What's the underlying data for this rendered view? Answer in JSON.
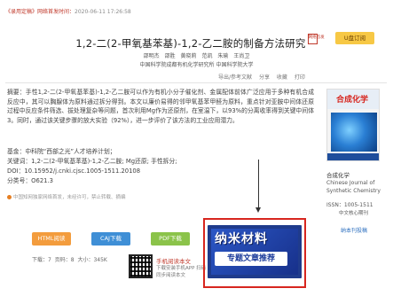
{
  "header": {
    "lead": "《录用定稿》网络首发时间：",
    "datetime": "2020-06-11 17:26:58",
    "title": "1,2-二(2-甲氧基苯基)-1,2-乙二胺的制备方法研究",
    "title_badge": "网络首发",
    "authors": [
      "邵明杰",
      "邵胜",
      "黄晓莉",
      "范凯",
      "朱瑜",
      "王尚卫"
    ],
    "affiliation": "中国科学院成都有机化学研究所    中国科学院大学",
    "u_button": "U盘订阅"
  },
  "toolbar": {
    "items": [
      "导出/参考文献",
      "分享",
      "收藏",
      "打印"
    ]
  },
  "abstract": {
    "text": "摘要：手性1,2-二(2-甲氧基苯基)-1,2-乙二胺可以作为有机小分子催化剂、金属配体前体广泛应用于多种有机合成反应中，其可以胸腺体为原料通过拆分得到。本文以廉价易得的邻甲氧基苯甲醛为原料，重点针对亚胺中间体还原过程中反应条件筛选、拔处理复杂等问题，首次利用Mg作为还原剂，在室温下，以93%的分离收率得到关键中间体3。同时，通过该关键步骤的放大实验（92%），进一步评价了该方法的工业应用潜力。",
    "fund": "基金：中科院“西部之光”人才培养计划；",
    "keywords": "关键词：1,2-二(2-甲氧基苯基)-1,2-乙二胺; Mg还原; 手性拆分;",
    "doi": "DOI：10.15952/j.cnki.cjsc.1005-1511.20108",
    "clc": "分类号：O621.3",
    "note": "中国知网独家网络首发，未经许可，禁止转载、摘编"
  },
  "downloads": {
    "html": "HTML阅读",
    "caj": "CAJ下载",
    "pdf": "PDF下载",
    "stats": "下载：7   页码：8   大小：345K"
  },
  "app_promo": {
    "title": "手机阅读本文",
    "desc": "下载安装手机APP 扫码同步阅读本文"
  },
  "ad": {
    "line1": "纳米材料",
    "line2": "专题文章推荐"
  },
  "journal": {
    "cover_name": "合成化学",
    "cn_name": "合成化学",
    "en_name": "Chinese Journal of Synthetic Chemistry",
    "issn": "ISSN：1005-1511",
    "core": "中文核心期刊",
    "follow": "纳本刊投稿"
  },
  "colors": {
    "html_btn": "#f39c3d",
    "caj_btn": "#3f8fd6",
    "pdf_btn": "#8bc34a",
    "highlight": "#d7261f",
    "ad_bg": "#1f3b8c"
  }
}
